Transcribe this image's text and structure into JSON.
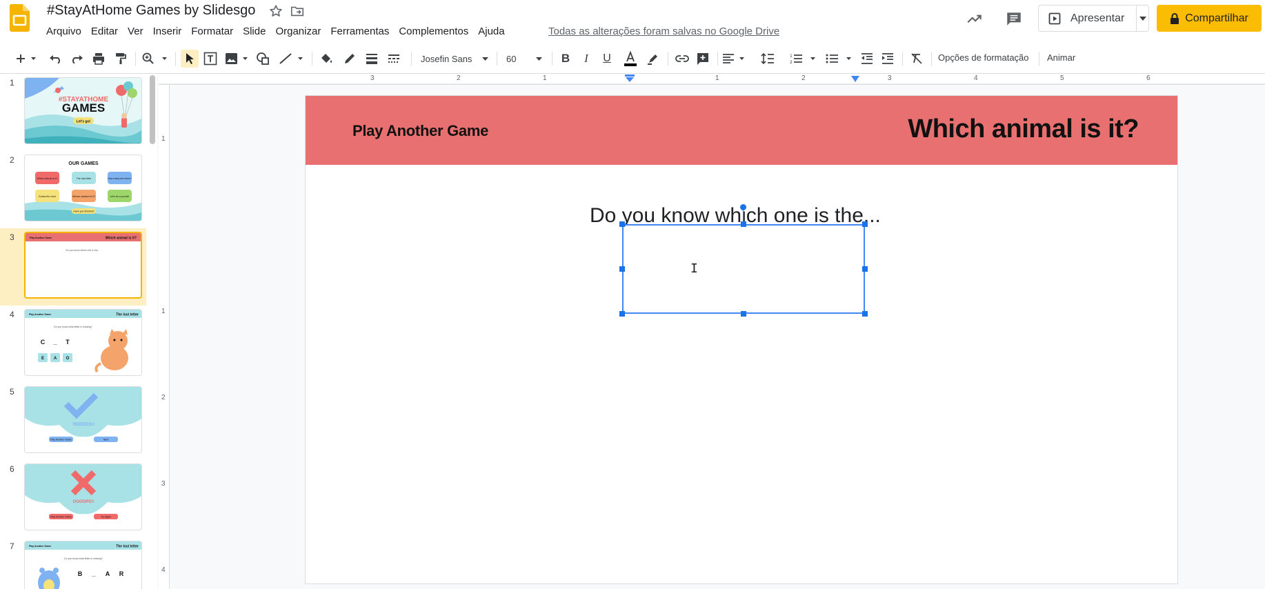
{
  "header": {
    "title": "#StayAtHome Games by Slidesgo",
    "menu": [
      "Arquivo",
      "Editar",
      "Ver",
      "Inserir",
      "Formatar",
      "Slide",
      "Organizar",
      "Ferramentas",
      "Complementos",
      "Ajuda"
    ],
    "saved_status": "Todas as alterações foram salvas no Google Drive",
    "present_label": "Apresentar",
    "share_label": "Compartilhar"
  },
  "toolbar": {
    "font_family": "Josefin Sans",
    "font_size": "60",
    "format_options": "Opções de formatação",
    "animate": "Animar"
  },
  "rulers": {
    "top": [
      "3",
      "2",
      "1",
      "1",
      "1",
      "2",
      "3",
      "4",
      "5",
      "6"
    ],
    "left": [
      "1",
      "1",
      "2",
      "3",
      "4"
    ]
  },
  "filmstrip": {
    "numbers": [
      "1",
      "2",
      "3",
      "4",
      "5",
      "6",
      "7"
    ],
    "selected": 3,
    "thumb1_tag": "#STAYATHOME",
    "thumb1_title": "GAMES",
    "thumb1_btn": "Let's go!",
    "thumb2_title": "OUR GAMES",
    "thumb2_games": [
      "Which animal is it?",
      "The lost letter",
      "How many are there?",
      "Guess the color",
      "Whose shadow is it?",
      "Let's do a puzzle!"
    ],
    "thumb2_finished": "Have you finished?",
    "thumb_play": "Play Another Game",
    "thumb3_title": "Which animal is it?",
    "thumb3_text": "Do you know which one is the...",
    "thumb4_title": "The lost letter",
    "thumb4_text": "Do you know what letter is missing?",
    "thumb4_letters": [
      "C",
      "_",
      "T"
    ],
    "thumb4_options": [
      "E",
      "A",
      "O"
    ],
    "thumb5_text": "YEEEEES!!",
    "thumb5_btn": "Next",
    "thumb6_text": "OOOOPS!!",
    "thumb6_btn": "Try Again",
    "thumb7_title": "The lost letter",
    "thumb7_letters": [
      "B",
      "_",
      "A",
      "R"
    ]
  },
  "slide": {
    "left_label": "Play Another Game",
    "title": "Which animal is it?",
    "subtitle": "Do you know which one is the..."
  },
  "colors": {
    "accent_yellow": "#fbbc04",
    "slide_header": "#e87070",
    "selection_blue": "#1a73e8"
  }
}
